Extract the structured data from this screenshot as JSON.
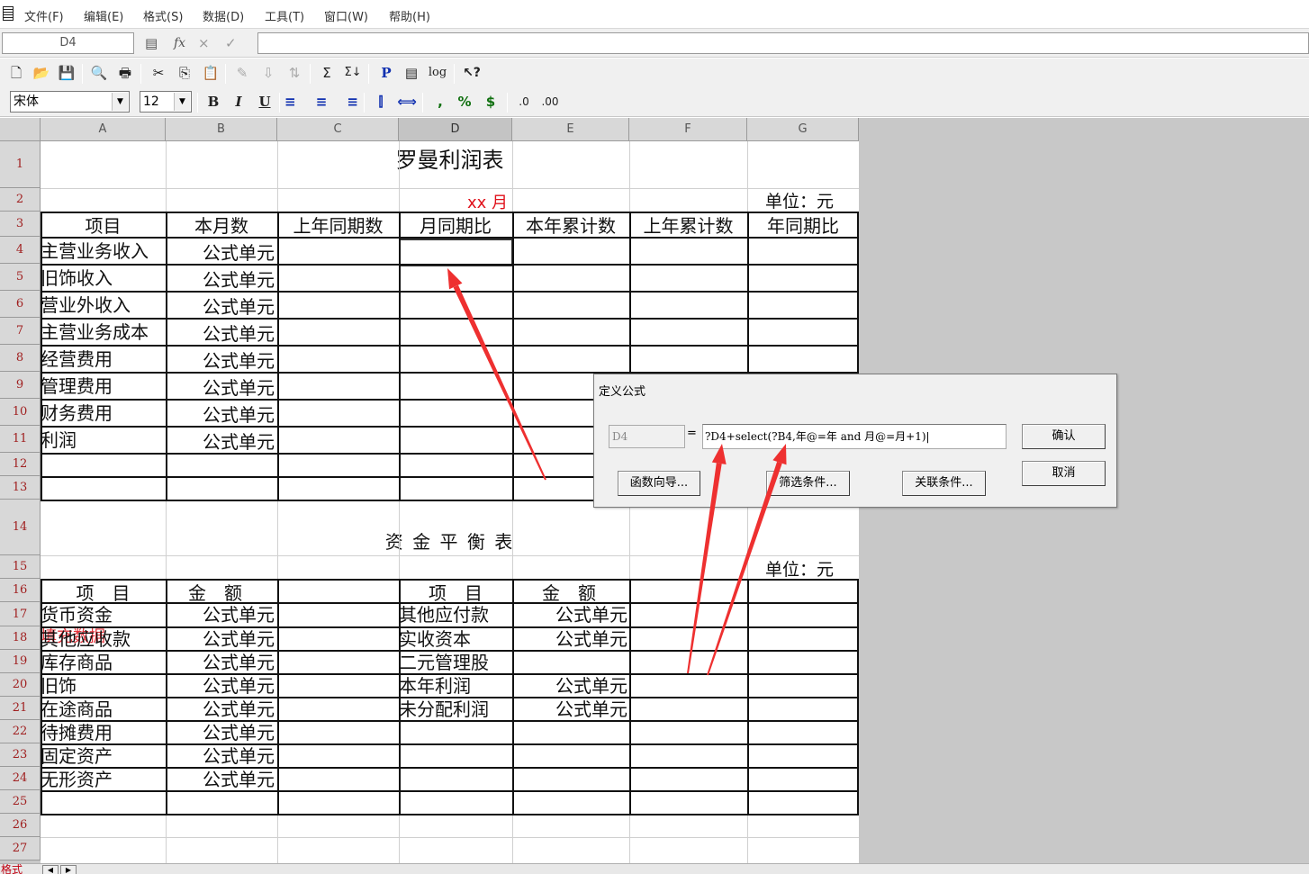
{
  "menu": [
    "文件(F)",
    "编辑(E)",
    "格式(S)",
    "数据(D)",
    "工具(T)",
    "窗口(W)",
    "帮助(H)"
  ],
  "name_box": "D4",
  "formula_bar": {
    "fx_icon": "fx",
    "cancel_icon": "×",
    "accept_icon": "✓",
    "content": ""
  },
  "toolbar1_icons": [
    {
      "name": "new-file-icon",
      "glyph": "🗋"
    },
    {
      "name": "open-folder-icon",
      "glyph": "📂"
    },
    {
      "name": "save-icon",
      "glyph": "💾"
    },
    {
      "name": "print-preview-icon",
      "glyph": "🔍"
    },
    {
      "name": "print-icon",
      "glyph": "🖶"
    },
    {
      "name": "cut-icon",
      "glyph": "✂"
    },
    {
      "name": "copy-icon",
      "glyph": "⎘"
    },
    {
      "name": "paste-icon",
      "glyph": "📋"
    },
    {
      "name": "format-painter-icon",
      "glyph": "✎"
    },
    {
      "name": "fill-icon",
      "glyph": "⇩"
    },
    {
      "name": "sort-icon",
      "glyph": "⇅"
    },
    {
      "name": "sum-icon",
      "glyph": "Σ"
    },
    {
      "name": "sum-all-icon",
      "glyph": "Σ↓"
    },
    {
      "name": "p-icon",
      "glyph": "P"
    },
    {
      "name": "page-icon",
      "glyph": "▤"
    },
    {
      "name": "log-icon",
      "glyph": "log"
    },
    {
      "name": "help-icon",
      "glyph": "↖?"
    }
  ],
  "font": {
    "family": "宋体",
    "size": "12"
  },
  "toolbar2_icons": [
    {
      "name": "bold-icon",
      "glyph": "B"
    },
    {
      "name": "italic-icon",
      "glyph": "I"
    },
    {
      "name": "underline-icon",
      "glyph": "U"
    },
    {
      "name": "align-left-icon",
      "glyph": "≡"
    },
    {
      "name": "align-center-icon",
      "glyph": "≡"
    },
    {
      "name": "align-right-icon",
      "glyph": "≡"
    },
    {
      "name": "merge-vertical-icon",
      "glyph": "⫿"
    },
    {
      "name": "merge-horizontal-icon",
      "glyph": "⟺"
    },
    {
      "name": "comma-style-icon",
      "glyph": ","
    },
    {
      "name": "percent-icon",
      "glyph": "%"
    },
    {
      "name": "currency-icon",
      "glyph": "$"
    },
    {
      "name": "increase-decimal-icon",
      "glyph": ".0"
    },
    {
      "name": "decrease-decimal-icon",
      "glyph": ".00"
    }
  ],
  "columns": [
    "A",
    "B",
    "C",
    "D",
    "E",
    "F",
    "G"
  ],
  "rows": [
    "1",
    "2",
    "3",
    "4",
    "5",
    "6",
    "7",
    "8",
    "9",
    "10",
    "11",
    "12",
    "13",
    "14",
    "15",
    "16",
    "17",
    "18",
    "19",
    "20",
    "21",
    "22",
    "23",
    "24",
    "25",
    "26",
    "27"
  ],
  "sheet": {
    "title1": "罗曼利润表",
    "month": "xx 月",
    "unit": "单位：元",
    "headers1": [
      "项目",
      "本月数",
      "上年同期数",
      "月同期比",
      "本年累计数",
      "上年累计数",
      "年同期比"
    ],
    "items1": [
      "主营业务收入",
      "旧饰收入",
      "营业外收入",
      "主营业务成本",
      "经营费用",
      "管理费用",
      "财务费用",
      "利润"
    ],
    "formula_cell": "公式单元",
    "title2": "资 金 平 衡 表",
    "unit2": "单位：元",
    "headers2": [
      "项　目",
      "金　额",
      "项　目",
      "金　额"
    ],
    "left_items": [
      "货币资金",
      "其他应收款",
      "库存商品",
      "旧饰",
      "在途商品",
      "待摊费用",
      "固定资产",
      "无形资产"
    ],
    "left_values": [
      "公式单元",
      "公式单元",
      "公式单元",
      "公式单元",
      "公式单元",
      "公式单元",
      "公式单元",
      "公式单元"
    ],
    "right_items": [
      "其他应付款",
      "实收资本",
      "二元管理股",
      "本年利润",
      "未分配利润"
    ],
    "right_values": [
      "公式单元",
      "公式单元",
      "",
      "公式单元",
      "公式单元"
    ],
    "overlay_red": "填充数据"
  },
  "dialog": {
    "title": "定义公式",
    "ref": "D4",
    "equals": "=",
    "expression": "?D4+select(?B4,年@=年 and 月@=月+1)|",
    "confirm": "确认",
    "cancel": "取消",
    "func_wizard": "函数向导...",
    "filter": "筛选条件...",
    "relation": "关联条件..."
  },
  "sheet_tab": {
    "label": "格式"
  }
}
